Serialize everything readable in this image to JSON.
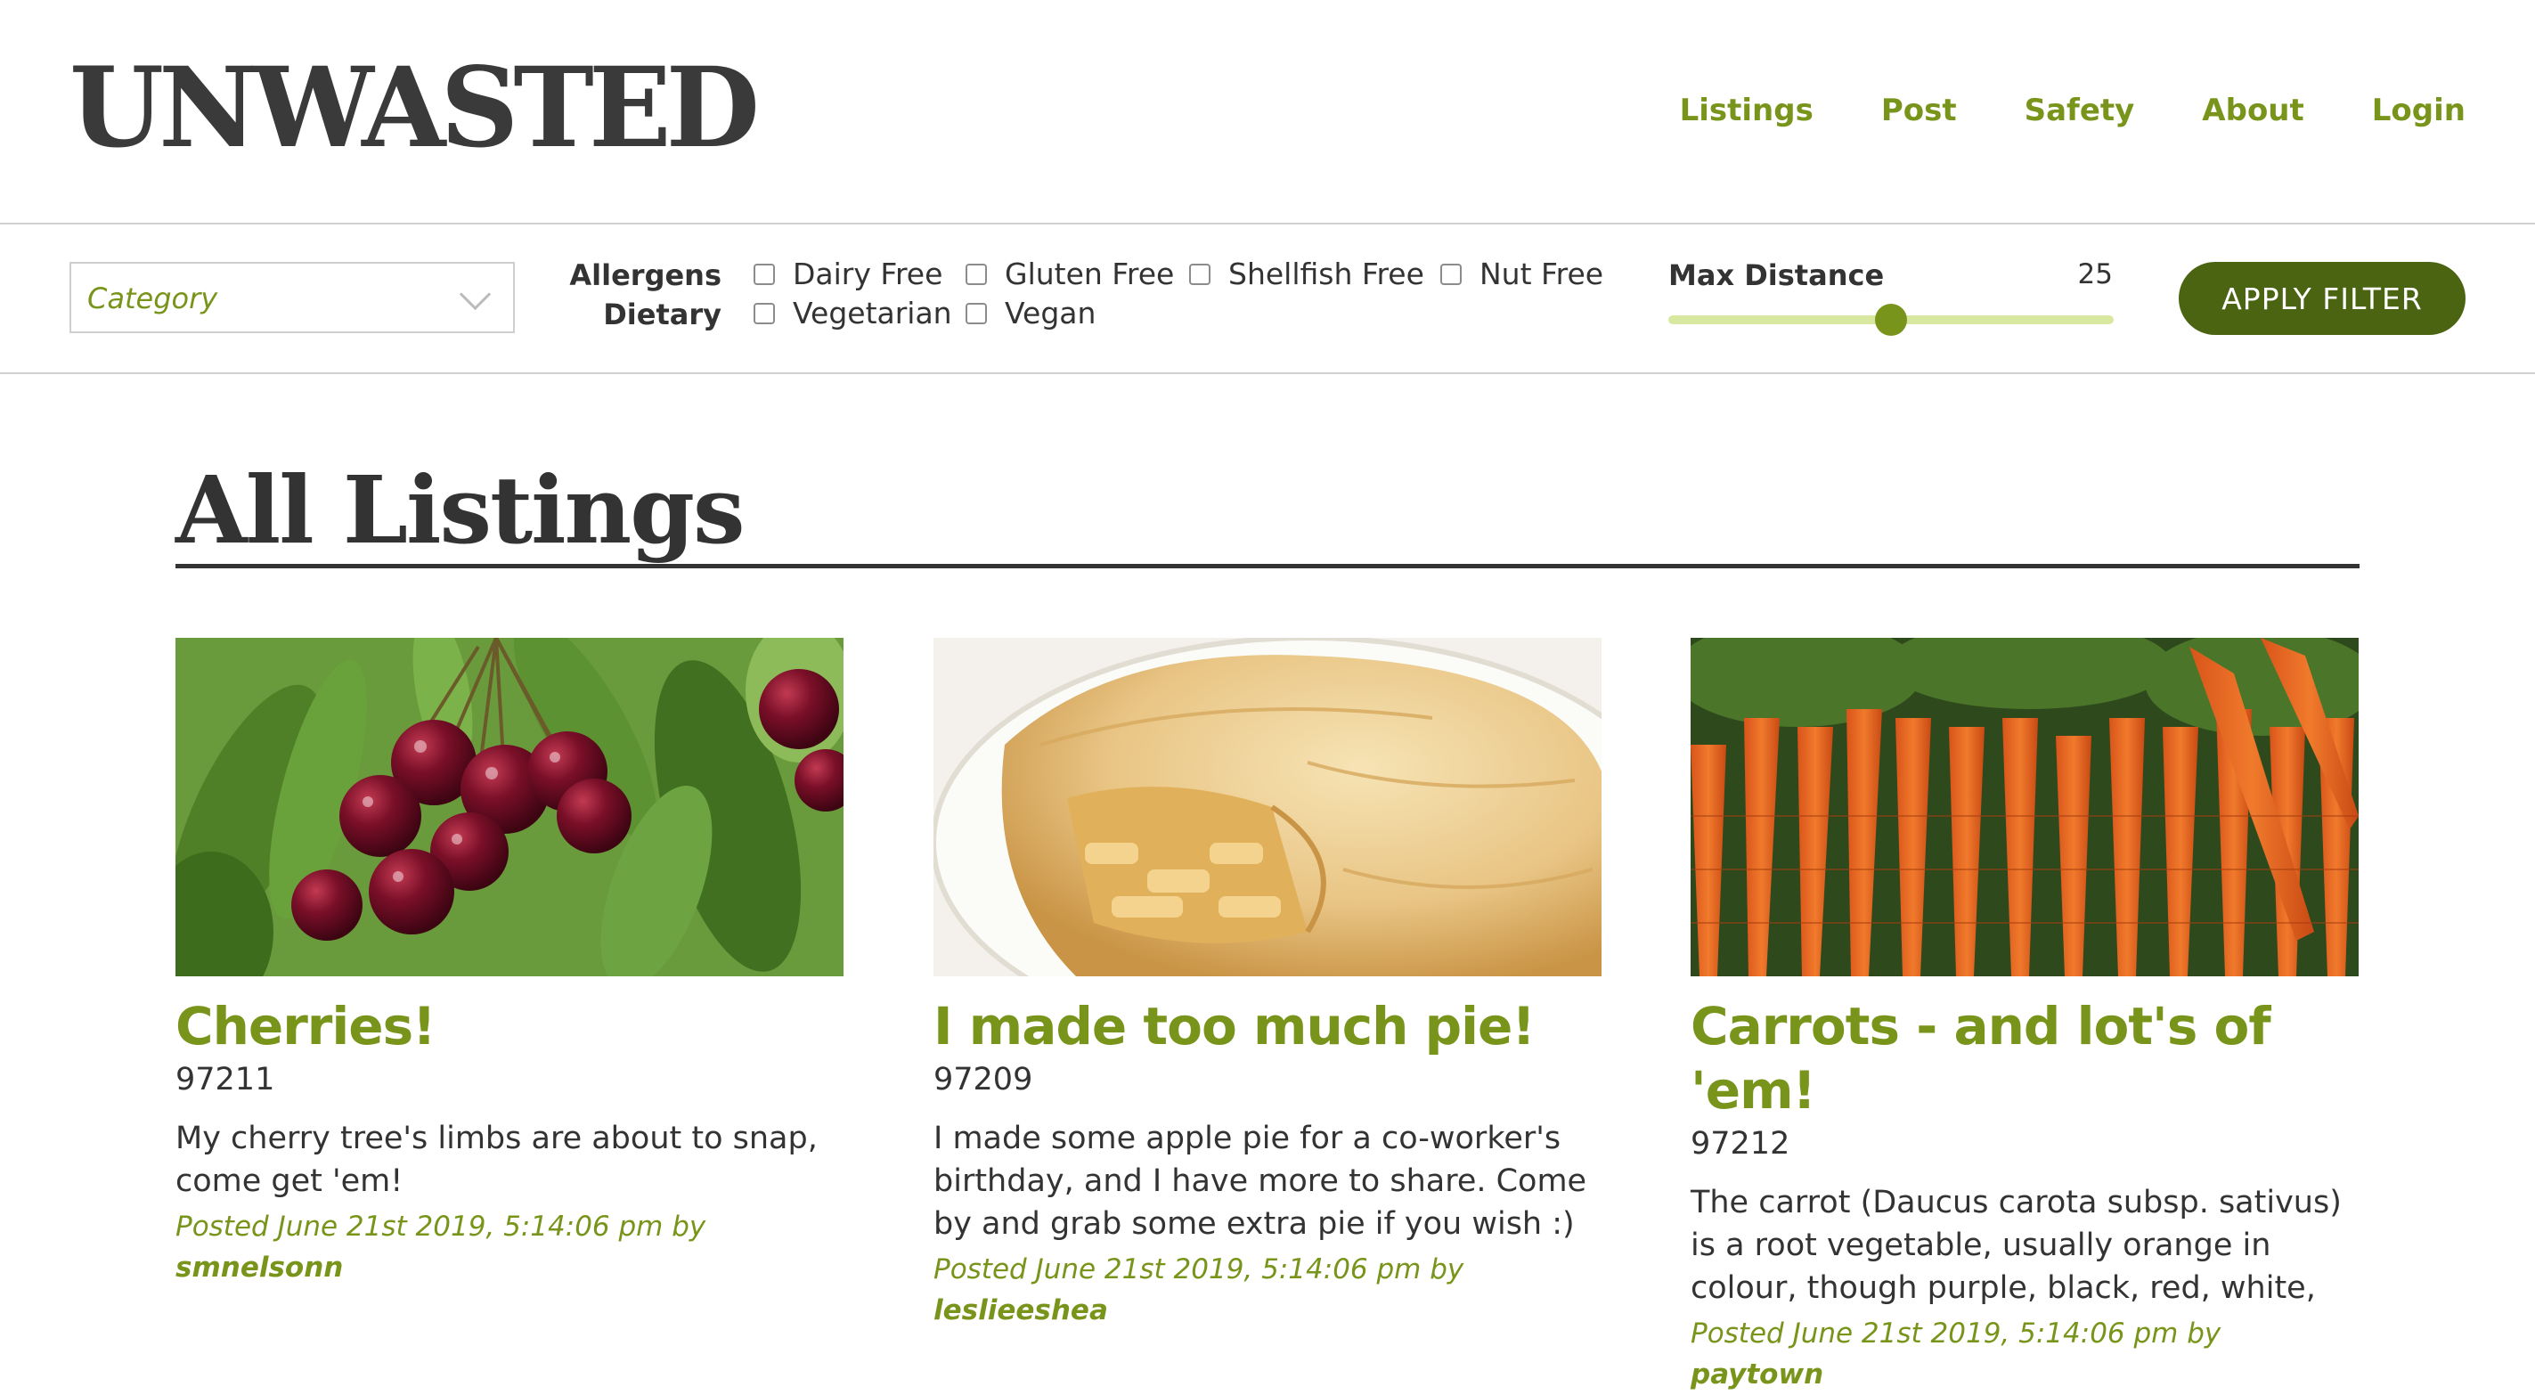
{
  "header": {
    "logo": "UNWASTED",
    "nav": [
      "Listings",
      "Post",
      "Safety",
      "About",
      "Login"
    ]
  },
  "filters": {
    "category_placeholder": "Category",
    "allergens_label": "Allergens",
    "dietary_label": "Dietary",
    "allergens": [
      {
        "label": "Dairy Free",
        "checked": false
      },
      {
        "label": "Gluten Free",
        "checked": false
      },
      {
        "label": "Shellfish Free",
        "checked": false
      },
      {
        "label": "Nut Free",
        "checked": false
      }
    ],
    "dietary": [
      {
        "label": "Vegetarian",
        "checked": false
      },
      {
        "label": "Vegan",
        "checked": false
      }
    ],
    "max_distance_label": "Max Distance",
    "max_distance_value": "25",
    "slider_fraction": 0.5,
    "apply_label": "APPLY FILTER"
  },
  "main": {
    "title": "All Listings"
  },
  "listings": [
    {
      "title": "Cherries!",
      "zip": "97211",
      "description": "My cherry tree's limbs are about to snap, come get 'em!",
      "posted": "Posted June 21st 2019, 5:14:06 pm by",
      "user": "smnelsonn"
    },
    {
      "title": "I made too much pie!",
      "zip": "97209",
      "description": "I made some apple pie for a co-worker's birthday, and I have more to share. Come by and grab some extra pie if you wish :)",
      "posted": "Posted June 21st 2019, 5:14:06 pm by",
      "user": "leslieeshea"
    },
    {
      "title": "Carrots - and lot's of 'em!",
      "zip": "97212",
      "description": "The carrot (Daucus carota subsp. sativus) is a root vegetable, usually orange in colour, though purple, black, red, white,",
      "posted": "Posted June 21st 2019, 5:14:06 pm by",
      "user": "paytown"
    }
  ],
  "colors": {
    "accent": "#79941a",
    "button": "#4a6411",
    "slider_track": "#d9e8a0"
  }
}
